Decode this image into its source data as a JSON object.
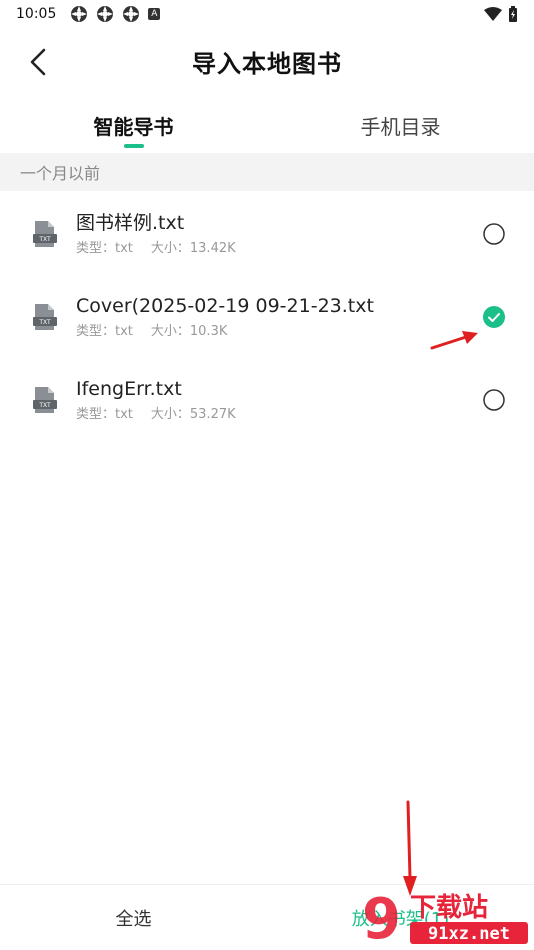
{
  "status_bar": {
    "time": "10:05",
    "left_badge": "A"
  },
  "header": {
    "title": "导入本地图书"
  },
  "tabs": [
    {
      "label": "智能导书",
      "active": true
    },
    {
      "label": "手机目录",
      "active": false
    }
  ],
  "section": {
    "label": "一个月以前"
  },
  "files": [
    {
      "name": "图书样例.txt",
      "type_label": "类型：txt",
      "size_label": "大小：13.42K",
      "selected": false
    },
    {
      "name": "Cover(2025-02-19 09-21-23.txt",
      "type_label": "类型：txt",
      "size_label": "大小：10.3K",
      "selected": true
    },
    {
      "name": "IfengErr.txt",
      "type_label": "类型：txt",
      "size_label": "大小：53.27K",
      "selected": false
    }
  ],
  "file_icon_label": "TXT",
  "bottom": {
    "select_all": "全选",
    "add_to_shelf": "放入书架(1)"
  },
  "watermark": {
    "top": "下载站",
    "bottom": "91xz.net",
    "digit": "9"
  },
  "colors": {
    "accent": "#1bbf8a",
    "arrow": "#e02020",
    "watermark": "#e8243a"
  },
  "icons": {
    "back": "chevron-left-icon",
    "file": "txt-file-icon",
    "check": "check-circle-icon"
  }
}
